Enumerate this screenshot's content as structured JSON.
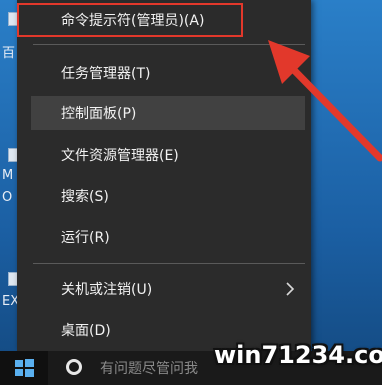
{
  "menu": {
    "items": [
      {
        "label": "命令提示符(管理员)(A)",
        "highlighted": true
      },
      {
        "label": "任务管理器(T)"
      },
      {
        "label": "控制面板(P)",
        "hover": true
      },
      {
        "label": "文件资源管理器(E)"
      },
      {
        "label": "搜索(S)"
      },
      {
        "label": "运行(R)"
      },
      {
        "label": "关机或注销(U)",
        "submenu": true
      },
      {
        "label": "桌面(D)"
      }
    ]
  },
  "desktop": {
    "labels": [
      "百",
      "M",
      "O",
      "EX"
    ]
  },
  "taskbar": {
    "search_placeholder": "有问题尽管问我"
  },
  "watermark": "win71234.com",
  "colors": {
    "menu_bg": "#2b2b2b",
    "hover_bg": "#414141",
    "highlight_border": "#e2382b",
    "arrow": "#e2382b",
    "desktop": "#1f6fb7"
  }
}
